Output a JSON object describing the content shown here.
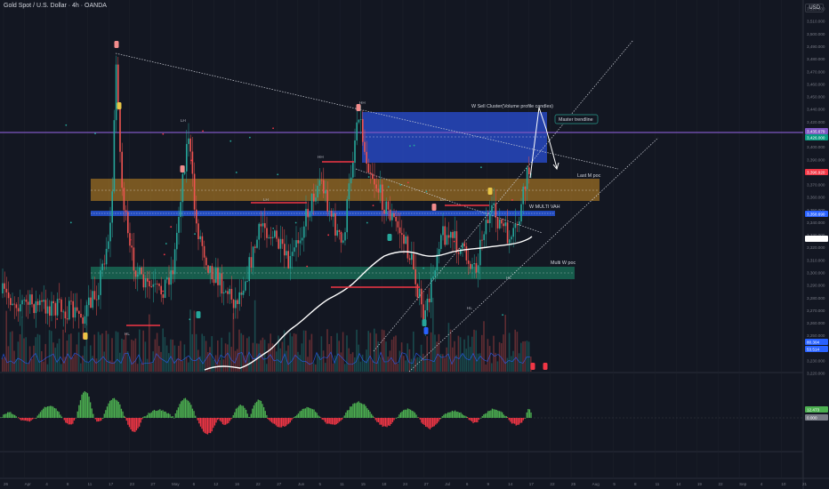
{
  "header": {
    "title": "Gold Spot / U.S. Dollar · 4h · OANDA",
    "currency": "USD"
  },
  "price_axis": {
    "labels": [
      "3,520.000",
      "3,510.000",
      "3,500.000",
      "3,490.000",
      "3,480.000",
      "3,470.000",
      "3,460.000",
      "3,450.000",
      "3,440.000",
      "3,420.000",
      "3,410.000",
      "3,400.000",
      "3,390.000",
      "3,380.000",
      "3,370.000",
      "3,360.000",
      "3,350.000",
      "3,340.000",
      "3,330.000",
      "3,320.000",
      "3,310.000",
      "3,300.000",
      "3,290.000",
      "3,280.000",
      "3,270.000",
      "3,260.000",
      "3,250.000",
      "3,240.000",
      "3,230.000",
      "3,220.000"
    ],
    "badges": [
      {
        "text": "3,435.679",
        "color": "#7e57c2"
      },
      {
        "text": "3,426.000",
        "color": "#089981"
      },
      {
        "text": "3,396.920",
        "color": "#f23645"
      },
      {
        "text": "3,358.690",
        "color": "#2962ff"
      },
      {
        "text": "3,335.904",
        "color": "#ffffff"
      },
      {
        "text": "80.304",
        "color": "#2962ff"
      },
      {
        "text": "53.514",
        "color": "#2962ff"
      }
    ]
  },
  "oscillator_axis": {
    "badges": [
      {
        "text": "12.473",
        "color": "#4caf50"
      },
      {
        "text": "0.000",
        "color": "#787b86"
      }
    ]
  },
  "time_axis": {
    "labels": [
      "26",
      "Apr",
      "4",
      "8",
      "11",
      "17",
      "23",
      "27",
      "May",
      "6",
      "12",
      "16",
      "22",
      "27",
      "Jun",
      "5",
      "11",
      "15",
      "18",
      "24",
      "27",
      "Jul",
      "6",
      "9",
      "14",
      "17",
      "22",
      "25",
      "Aug",
      "5",
      "8",
      "11",
      "14",
      "19",
      "22",
      "Sep",
      "4",
      "10",
      "21"
    ]
  },
  "annotations": {
    "w_sell_cluster": "W Sell Cluster(Volume profile candles)",
    "master_trendline": "Master trendline",
    "last_m_poc": "Last M poc",
    "w_multi_vah": "W MULTI VAH",
    "multi_w_poc": "Multi W poc",
    "lh": "LH",
    "hh": "HH",
    "hl": "HL"
  },
  "colors": {
    "background": "#131722",
    "up_candle": "#26a69a",
    "down_candle": "#ef5350",
    "sell_cluster": "#2a4fd6",
    "poc_band": "#f5a623",
    "vah_line": "#2962ff",
    "multi_w_poc": "#1a7a5e",
    "oscillator_up": "#4caf50",
    "oscillator_down": "#f23645"
  }
}
